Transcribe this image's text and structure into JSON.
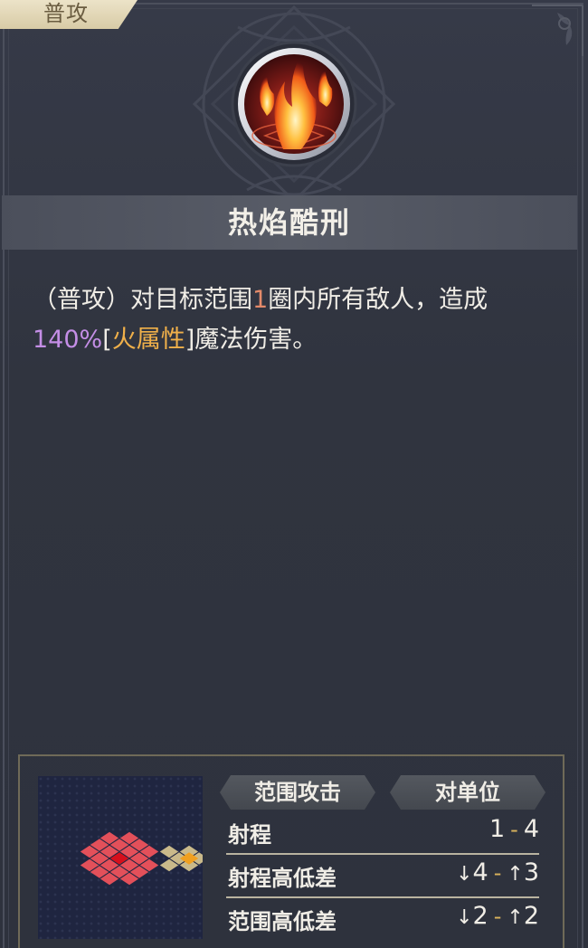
{
  "tab": {
    "label": "普攻"
  },
  "skill": {
    "name": "热焰酷刑",
    "desc": {
      "part1": "（普攻）对目标范围",
      "range_num": "1",
      "part2": "圈内所有敌人，造成",
      "percent": "140%",
      "bracket_open": "[",
      "element": "火属性",
      "bracket_close": "]",
      "part3": "魔法伤害。"
    }
  },
  "panel": {
    "tags": [
      "范围攻击",
      "对单位"
    ],
    "stats": [
      {
        "label": "射程",
        "from": "1",
        "sep": "-",
        "to": "4"
      },
      {
        "label": "射程高低差",
        "from_arrow": "↓",
        "from": "4",
        "sep": "-",
        "to_arrow": "↑",
        "to": "3"
      },
      {
        "label": "范围高低差",
        "from_arrow": "↓",
        "from": "2",
        "sep": "-",
        "to_arrow": "↑",
        "to": "2"
      }
    ]
  },
  "colors": {
    "background": "#2f3341",
    "aoe_tile": "#e3505a",
    "center_tile": "#d60f1c",
    "origin_tile": "#c9b98a",
    "caster_tile": "#f0a020",
    "percent_text": "#c48ee6",
    "element_text": "#f0b04a"
  },
  "icons": [
    "fire-skill-icon",
    "corner-ornament-icon",
    "range-grid-map"
  ]
}
